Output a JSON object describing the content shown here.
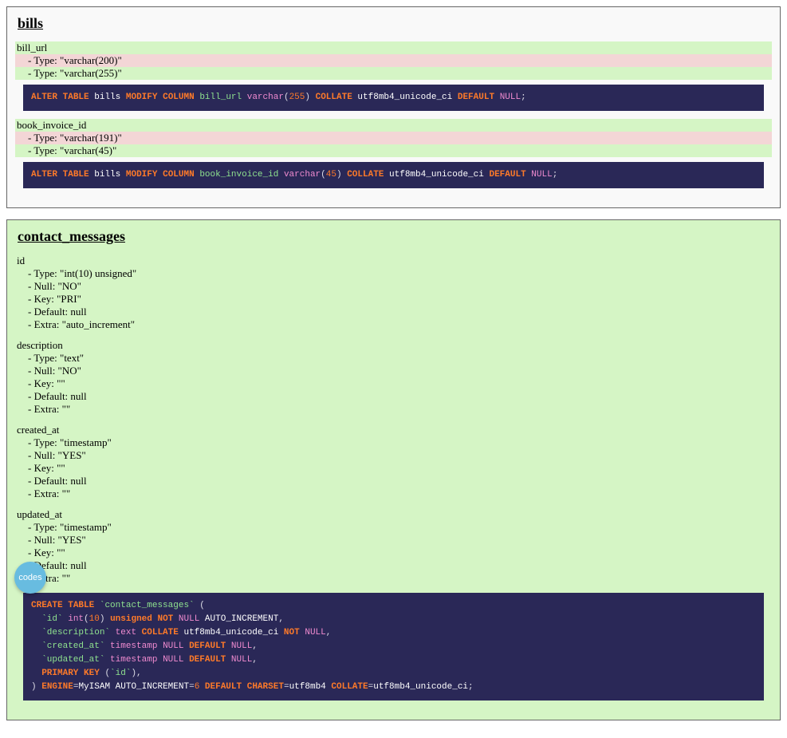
{
  "fab_label": "codes",
  "tables": [
    {
      "name": "bills",
      "added": false,
      "columns": [
        {
          "name": "bill_url",
          "name_changed": true,
          "props": [
            {
              "text": "- Type: \"varchar(200)\"",
              "state": "removed"
            },
            {
              "text": "- Type: \"varchar(255)\"",
              "state": "added"
            }
          ]
        },
        {
          "name": "book_invoice_id",
          "name_changed": true,
          "props": [
            {
              "text": "- Type: \"varchar(191)\"",
              "state": "removed"
            },
            {
              "text": "- Type: \"varchar(45)\"",
              "state": "added"
            }
          ]
        }
      ]
    },
    {
      "name": "contact_messages",
      "added": true,
      "columns": [
        {
          "name": "id",
          "name_changed": false,
          "props": [
            {
              "text": "- Type: \"int(10) unsigned\"",
              "state": ""
            },
            {
              "text": "- Null: \"NO\"",
              "state": ""
            },
            {
              "text": "- Key: \"PRI\"",
              "state": ""
            },
            {
              "text": "- Default: null",
              "state": ""
            },
            {
              "text": "- Extra: \"auto_increment\"",
              "state": ""
            }
          ]
        },
        {
          "name": "description",
          "name_changed": false,
          "props": [
            {
              "text": "- Type: \"text\"",
              "state": ""
            },
            {
              "text": "- Null: \"NO\"",
              "state": ""
            },
            {
              "text": "- Key: \"\"",
              "state": ""
            },
            {
              "text": "- Default: null",
              "state": ""
            },
            {
              "text": "- Extra: \"\"",
              "state": ""
            }
          ]
        },
        {
          "name": "created_at",
          "name_changed": false,
          "props": [
            {
              "text": "- Type: \"timestamp\"",
              "state": ""
            },
            {
              "text": "- Null: \"YES\"",
              "state": ""
            },
            {
              "text": "- Key: \"\"",
              "state": ""
            },
            {
              "text": "- Default: null",
              "state": ""
            },
            {
              "text": "- Extra: \"\"",
              "state": ""
            }
          ]
        },
        {
          "name": "updated_at",
          "name_changed": false,
          "props": [
            {
              "text": "- Type: \"timestamp\"",
              "state": ""
            },
            {
              "text": "- Null: \"YES\"",
              "state": ""
            },
            {
              "text": "- Key: \"\"",
              "state": ""
            },
            {
              "text": "- Default: null",
              "state": ""
            },
            {
              "text": "- Extra: \"\"",
              "state": ""
            }
          ]
        }
      ]
    }
  ],
  "sql": {
    "bills_bill_url": [
      {
        "t": "ALTER",
        "c": "tok-kw"
      },
      {
        "t": " ",
        "c": ""
      },
      {
        "t": "TABLE",
        "c": "tok-kw"
      },
      {
        "t": " ",
        "c": ""
      },
      {
        "t": "bills",
        "c": "tok-id"
      },
      {
        "t": " ",
        "c": ""
      },
      {
        "t": "MODIFY",
        "c": "tok-kw"
      },
      {
        "t": " ",
        "c": ""
      },
      {
        "t": "COLUMN",
        "c": "tok-kw"
      },
      {
        "t": " ",
        "c": ""
      },
      {
        "t": "bill_url",
        "c": "tok-id2"
      },
      {
        "t": " ",
        "c": ""
      },
      {
        "t": "varchar",
        "c": "tok-type"
      },
      {
        "t": "(",
        "c": "tok-punct"
      },
      {
        "t": "255",
        "c": "tok-num"
      },
      {
        "t": ")",
        "c": "tok-punct"
      },
      {
        "t": " ",
        "c": ""
      },
      {
        "t": "COLLATE",
        "c": "tok-kw"
      },
      {
        "t": " ",
        "c": ""
      },
      {
        "t": "utf8mb4_unicode_ci",
        "c": "tok-id"
      },
      {
        "t": " ",
        "c": ""
      },
      {
        "t": "DEFAULT",
        "c": "tok-kw"
      },
      {
        "t": " ",
        "c": ""
      },
      {
        "t": "NULL",
        "c": "tok-type"
      },
      {
        "t": ";",
        "c": "tok-punct"
      }
    ],
    "bills_book_invoice_id": [
      {
        "t": "ALTER",
        "c": "tok-kw"
      },
      {
        "t": " ",
        "c": ""
      },
      {
        "t": "TABLE",
        "c": "tok-kw"
      },
      {
        "t": " ",
        "c": ""
      },
      {
        "t": "bills",
        "c": "tok-id"
      },
      {
        "t": " ",
        "c": ""
      },
      {
        "t": "MODIFY",
        "c": "tok-kw"
      },
      {
        "t": " ",
        "c": ""
      },
      {
        "t": "COLUMN",
        "c": "tok-kw"
      },
      {
        "t": " ",
        "c": ""
      },
      {
        "t": "book_invoice_id",
        "c": "tok-id2"
      },
      {
        "t": " ",
        "c": ""
      },
      {
        "t": "varchar",
        "c": "tok-type"
      },
      {
        "t": "(",
        "c": "tok-punct"
      },
      {
        "t": "45",
        "c": "tok-num"
      },
      {
        "t": ")",
        "c": "tok-punct"
      },
      {
        "t": " ",
        "c": ""
      },
      {
        "t": "COLLATE",
        "c": "tok-kw"
      },
      {
        "t": " ",
        "c": ""
      },
      {
        "t": "utf8mb4_unicode_ci",
        "c": "tok-id"
      },
      {
        "t": " ",
        "c": ""
      },
      {
        "t": "DEFAULT",
        "c": "tok-kw"
      },
      {
        "t": " ",
        "c": ""
      },
      {
        "t": "NULL",
        "c": "tok-type"
      },
      {
        "t": ";",
        "c": "tok-punct"
      }
    ],
    "contact_messages_create": [
      {
        "t": "CREATE",
        "c": "tok-kw"
      },
      {
        "t": " ",
        "c": ""
      },
      {
        "t": "TABLE",
        "c": "tok-kw"
      },
      {
        "t": " ",
        "c": ""
      },
      {
        "t": "`contact_messages`",
        "c": "tok-str"
      },
      {
        "t": " (",
        "c": "tok-punct"
      },
      {
        "t": "\n  ",
        "c": ""
      },
      {
        "t": "`id`",
        "c": "tok-str"
      },
      {
        "t": " ",
        "c": ""
      },
      {
        "t": "int",
        "c": "tok-type"
      },
      {
        "t": "(",
        "c": "tok-punct"
      },
      {
        "t": "10",
        "c": "tok-num"
      },
      {
        "t": ")",
        "c": "tok-punct"
      },
      {
        "t": " ",
        "c": ""
      },
      {
        "t": "unsigned",
        "c": "tok-kw"
      },
      {
        "t": " ",
        "c": ""
      },
      {
        "t": "NOT",
        "c": "tok-kw"
      },
      {
        "t": " ",
        "c": ""
      },
      {
        "t": "NULL",
        "c": "tok-type"
      },
      {
        "t": " ",
        "c": ""
      },
      {
        "t": "AUTO_INCREMENT",
        "c": "tok-id"
      },
      {
        "t": ",",
        "c": "tok-punct"
      },
      {
        "t": "\n  ",
        "c": ""
      },
      {
        "t": "`description`",
        "c": "tok-str"
      },
      {
        "t": " ",
        "c": ""
      },
      {
        "t": "text",
        "c": "tok-type"
      },
      {
        "t": " ",
        "c": ""
      },
      {
        "t": "COLLATE",
        "c": "tok-kw"
      },
      {
        "t": " ",
        "c": ""
      },
      {
        "t": "utf8mb4_unicode_ci",
        "c": "tok-id"
      },
      {
        "t": " ",
        "c": ""
      },
      {
        "t": "NOT",
        "c": "tok-kw"
      },
      {
        "t": " ",
        "c": ""
      },
      {
        "t": "NULL",
        "c": "tok-type"
      },
      {
        "t": ",",
        "c": "tok-punct"
      },
      {
        "t": "\n  ",
        "c": ""
      },
      {
        "t": "`created_at`",
        "c": "tok-str"
      },
      {
        "t": " ",
        "c": ""
      },
      {
        "t": "timestamp",
        "c": "tok-type"
      },
      {
        "t": " ",
        "c": ""
      },
      {
        "t": "NULL",
        "c": "tok-type"
      },
      {
        "t": " ",
        "c": ""
      },
      {
        "t": "DEFAULT",
        "c": "tok-kw"
      },
      {
        "t": " ",
        "c": ""
      },
      {
        "t": "NULL",
        "c": "tok-type"
      },
      {
        "t": ",",
        "c": "tok-punct"
      },
      {
        "t": "\n  ",
        "c": ""
      },
      {
        "t": "`updated_at`",
        "c": "tok-str"
      },
      {
        "t": " ",
        "c": ""
      },
      {
        "t": "timestamp",
        "c": "tok-type"
      },
      {
        "t": " ",
        "c": ""
      },
      {
        "t": "NULL",
        "c": "tok-type"
      },
      {
        "t": " ",
        "c": ""
      },
      {
        "t": "DEFAULT",
        "c": "tok-kw"
      },
      {
        "t": " ",
        "c": ""
      },
      {
        "t": "NULL",
        "c": "tok-type"
      },
      {
        "t": ",",
        "c": "tok-punct"
      },
      {
        "t": "\n  ",
        "c": ""
      },
      {
        "t": "PRIMARY",
        "c": "tok-kw"
      },
      {
        "t": " ",
        "c": ""
      },
      {
        "t": "KEY",
        "c": "tok-kw"
      },
      {
        "t": " (",
        "c": "tok-punct"
      },
      {
        "t": "`id`",
        "c": "tok-str"
      },
      {
        "t": "),",
        "c": "tok-punct"
      },
      {
        "t": "\n",
        "c": ""
      },
      {
        "t": ")",
        "c": "tok-punct"
      },
      {
        "t": " ",
        "c": ""
      },
      {
        "t": "ENGINE",
        "c": "tok-kw"
      },
      {
        "t": "=",
        "c": "tok-punct"
      },
      {
        "t": "MyISAM",
        "c": "tok-id"
      },
      {
        "t": " ",
        "c": ""
      },
      {
        "t": "AUTO_INCREMENT",
        "c": "tok-id"
      },
      {
        "t": "=",
        "c": "tok-punct"
      },
      {
        "t": "6",
        "c": "tok-num"
      },
      {
        "t": " ",
        "c": ""
      },
      {
        "t": "DEFAULT",
        "c": "tok-kw"
      },
      {
        "t": " ",
        "c": ""
      },
      {
        "t": "CHARSET",
        "c": "tok-kw"
      },
      {
        "t": "=",
        "c": "tok-punct"
      },
      {
        "t": "utf8mb4",
        "c": "tok-id"
      },
      {
        "t": " ",
        "c": ""
      },
      {
        "t": "COLLATE",
        "c": "tok-kw"
      },
      {
        "t": "=",
        "c": "tok-punct"
      },
      {
        "t": "utf8mb4_unicode_ci",
        "c": "tok-id"
      },
      {
        "t": ";",
        "c": "tok-punct"
      }
    ]
  }
}
